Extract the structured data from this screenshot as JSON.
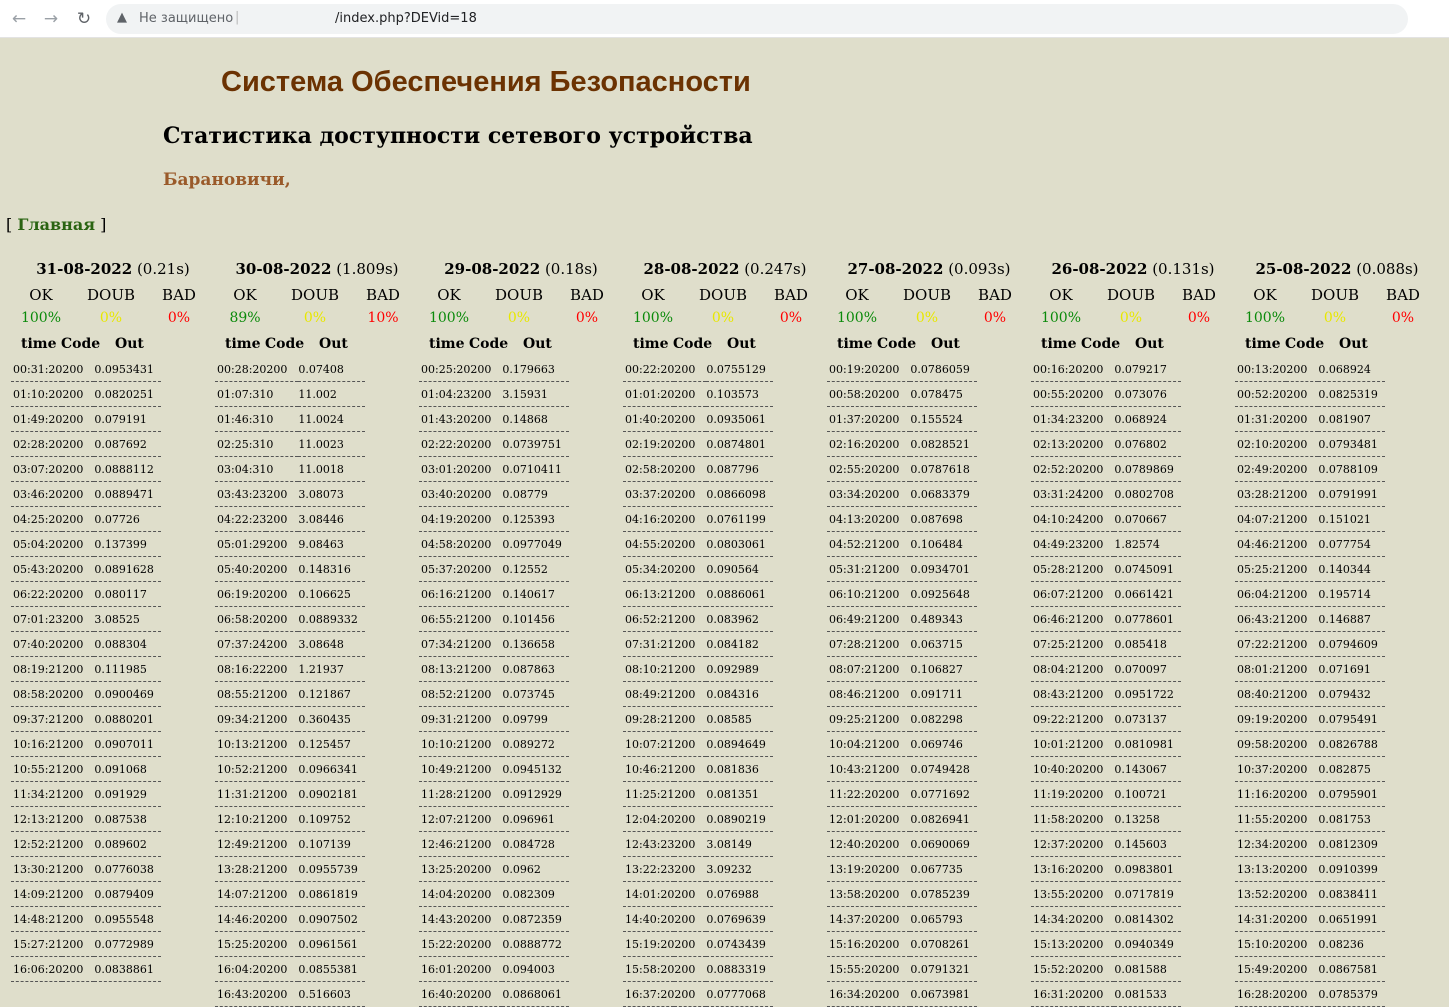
{
  "browser": {
    "security_label": "Не защищено",
    "url": "/index.php?DEVid=18"
  },
  "page": {
    "title": "Система Обеспечения Безопасности",
    "subtitle": "Статистика доступности сетевого устройства",
    "location": "Барановичи,",
    "nav": {
      "open_bracket": "[",
      "main_link": "Главная",
      "close_bracket": "]"
    }
  },
  "headers": {
    "ok": "OK",
    "doub": "DOUB",
    "bad": "BAD",
    "time": "time",
    "code": "Code",
    "out": "Out"
  },
  "colors": {
    "ok": "#0a8a0a",
    "doub": "#e8e800",
    "bad": "#ff0000",
    "title": "#6b3202",
    "link": "#2a6412",
    "location": "#9a5a2a"
  },
  "days": [
    {
      "date": "31-08-2022",
      "duration": "(0.21s)",
      "ok": "100%",
      "doub": "0%",
      "bad": "0%",
      "rows": [
        [
          "00:31:20",
          "200",
          "0.0953431"
        ],
        [
          "01:10:20",
          "200",
          "0.0820251"
        ],
        [
          "01:49:20",
          "200",
          "0.079191"
        ],
        [
          "02:28:20",
          "200",
          "0.087692"
        ],
        [
          "03:07:20",
          "200",
          "0.0888112"
        ],
        [
          "03:46:20",
          "200",
          "0.0889471"
        ],
        [
          "04:25:20",
          "200",
          "0.07726"
        ],
        [
          "05:04:20",
          "200",
          "0.137399"
        ],
        [
          "05:43:20",
          "200",
          "0.0891628"
        ],
        [
          "06:22:20",
          "200",
          "0.080117"
        ],
        [
          "07:01:23",
          "200",
          "3.08525"
        ],
        [
          "07:40:20",
          "200",
          "0.088304"
        ],
        [
          "08:19:21",
          "200",
          "0.111985"
        ],
        [
          "08:58:20",
          "200",
          "0.0900469"
        ],
        [
          "09:37:21",
          "200",
          "0.0880201"
        ],
        [
          "10:16:21",
          "200",
          "0.0907011"
        ],
        [
          "10:55:21",
          "200",
          "0.091068"
        ],
        [
          "11:34:21",
          "200",
          "0.091929"
        ],
        [
          "12:13:21",
          "200",
          "0.087538"
        ],
        [
          "12:52:21",
          "200",
          "0.089602"
        ],
        [
          "13:30:21",
          "200",
          "0.0776038"
        ],
        [
          "14:09:21",
          "200",
          "0.0879409"
        ],
        [
          "14:48:21",
          "200",
          "0.0955548"
        ],
        [
          "15:27:21",
          "200",
          "0.0772989"
        ],
        [
          "16:06:20",
          "200",
          "0.0838861"
        ]
      ]
    },
    {
      "date": "30-08-2022",
      "duration": "(1.809s)",
      "ok": "89%",
      "doub": "0%",
      "bad": "10%",
      "rows": [
        [
          "00:28:20",
          "200",
          "0.07408"
        ],
        [
          "01:07:31",
          "0",
          "11.002"
        ],
        [
          "01:46:31",
          "0",
          "11.0024"
        ],
        [
          "02:25:31",
          "0",
          "11.0023"
        ],
        [
          "03:04:31",
          "0",
          "11.0018"
        ],
        [
          "03:43:23",
          "200",
          "3.08073"
        ],
        [
          "04:22:23",
          "200",
          "3.08446"
        ],
        [
          "05:01:29",
          "200",
          "9.08463"
        ],
        [
          "05:40:20",
          "200",
          "0.148316"
        ],
        [
          "06:19:20",
          "200",
          "0.106625"
        ],
        [
          "06:58:20",
          "200",
          "0.0889332"
        ],
        [
          "07:37:24",
          "200",
          "3.08648"
        ],
        [
          "08:16:22",
          "200",
          "1.21937"
        ],
        [
          "08:55:21",
          "200",
          "0.121867"
        ],
        [
          "09:34:21",
          "200",
          "0.360435"
        ],
        [
          "10:13:21",
          "200",
          "0.125457"
        ],
        [
          "10:52:21",
          "200",
          "0.0966341"
        ],
        [
          "11:31:21",
          "200",
          "0.0902181"
        ],
        [
          "12:10:21",
          "200",
          "0.109752"
        ],
        [
          "12:49:21",
          "200",
          "0.107139"
        ],
        [
          "13:28:21",
          "200",
          "0.0955739"
        ],
        [
          "14:07:21",
          "200",
          "0.0861819"
        ],
        [
          "14:46:20",
          "200",
          "0.0907502"
        ],
        [
          "15:25:20",
          "200",
          "0.0961561"
        ],
        [
          "16:04:20",
          "200",
          "0.0855381"
        ],
        [
          "16:43:20",
          "200",
          "0.516603"
        ]
      ]
    },
    {
      "date": "29-08-2022",
      "duration": "(0.18s)",
      "ok": "100%",
      "doub": "0%",
      "bad": "0%",
      "rows": [
        [
          "00:25:20",
          "200",
          "0.179663"
        ],
        [
          "01:04:23",
          "200",
          "3.15931"
        ],
        [
          "01:43:20",
          "200",
          "0.14868"
        ],
        [
          "02:22:20",
          "200",
          "0.0739751"
        ],
        [
          "03:01:20",
          "200",
          "0.0710411"
        ],
        [
          "03:40:20",
          "200",
          "0.08779"
        ],
        [
          "04:19:20",
          "200",
          "0.125393"
        ],
        [
          "04:58:20",
          "200",
          "0.0977049"
        ],
        [
          "05:37:20",
          "200",
          "0.12552"
        ],
        [
          "06:16:21",
          "200",
          "0.140617"
        ],
        [
          "06:55:21",
          "200",
          "0.101456"
        ],
        [
          "07:34:21",
          "200",
          "0.136658"
        ],
        [
          "08:13:21",
          "200",
          "0.087863"
        ],
        [
          "08:52:21",
          "200",
          "0.073745"
        ],
        [
          "09:31:21",
          "200",
          "0.09799"
        ],
        [
          "10:10:21",
          "200",
          "0.089272"
        ],
        [
          "10:49:21",
          "200",
          "0.0945132"
        ],
        [
          "11:28:21",
          "200",
          "0.0912929"
        ],
        [
          "12:07:21",
          "200",
          "0.096961"
        ],
        [
          "12:46:21",
          "200",
          "0.084728"
        ],
        [
          "13:25:20",
          "200",
          "0.0962"
        ],
        [
          "14:04:20",
          "200",
          "0.082309"
        ],
        [
          "14:43:20",
          "200",
          "0.0872359"
        ],
        [
          "15:22:20",
          "200",
          "0.0888772"
        ],
        [
          "16:01:20",
          "200",
          "0.094003"
        ],
        [
          "16:40:20",
          "200",
          "0.0868061"
        ]
      ]
    },
    {
      "date": "28-08-2022",
      "duration": "(0.247s)",
      "ok": "100%",
      "doub": "0%",
      "bad": "0%",
      "rows": [
        [
          "00:22:20",
          "200",
          "0.0755129"
        ],
        [
          "01:01:20",
          "200",
          "0.103573"
        ],
        [
          "01:40:20",
          "200",
          "0.0935061"
        ],
        [
          "02:19:20",
          "200",
          "0.0874801"
        ],
        [
          "02:58:20",
          "200",
          "0.087796"
        ],
        [
          "03:37:20",
          "200",
          "0.0866098"
        ],
        [
          "04:16:20",
          "200",
          "0.0761199"
        ],
        [
          "04:55:20",
          "200",
          "0.0803061"
        ],
        [
          "05:34:20",
          "200",
          "0.090564"
        ],
        [
          "06:13:21",
          "200",
          "0.0886061"
        ],
        [
          "06:52:21",
          "200",
          "0.083962"
        ],
        [
          "07:31:21",
          "200",
          "0.084182"
        ],
        [
          "08:10:21",
          "200",
          "0.092989"
        ],
        [
          "08:49:21",
          "200",
          "0.084316"
        ],
        [
          "09:28:21",
          "200",
          "0.08585"
        ],
        [
          "10:07:21",
          "200",
          "0.0894649"
        ],
        [
          "10:46:21",
          "200",
          "0.081836"
        ],
        [
          "11:25:21",
          "200",
          "0.081351"
        ],
        [
          "12:04:20",
          "200",
          "0.0890219"
        ],
        [
          "12:43:23",
          "200",
          "3.08149"
        ],
        [
          "13:22:23",
          "200",
          "3.09232"
        ],
        [
          "14:01:20",
          "200",
          "0.076988"
        ],
        [
          "14:40:20",
          "200",
          "0.0769639"
        ],
        [
          "15:19:20",
          "200",
          "0.0743439"
        ],
        [
          "15:58:20",
          "200",
          "0.0883319"
        ],
        [
          "16:37:20",
          "200",
          "0.0777068"
        ]
      ]
    },
    {
      "date": "27-08-2022",
      "duration": "(0.093s)",
      "ok": "100%",
      "doub": "0%",
      "bad": "0%",
      "rows": [
        [
          "00:19:20",
          "200",
          "0.0786059"
        ],
        [
          "00:58:20",
          "200",
          "0.078475"
        ],
        [
          "01:37:20",
          "200",
          "0.155524"
        ],
        [
          "02:16:20",
          "200",
          "0.0828521"
        ],
        [
          "02:55:20",
          "200",
          "0.0787618"
        ],
        [
          "03:34:20",
          "200",
          "0.0683379"
        ],
        [
          "04:13:20",
          "200",
          "0.087698"
        ],
        [
          "04:52:21",
          "200",
          "0.106484"
        ],
        [
          "05:31:21",
          "200",
          "0.0934701"
        ],
        [
          "06:10:21",
          "200",
          "0.0925648"
        ],
        [
          "06:49:21",
          "200",
          "0.489343"
        ],
        [
          "07:28:21",
          "200",
          "0.063715"
        ],
        [
          "08:07:21",
          "200",
          "0.106827"
        ],
        [
          "08:46:21",
          "200",
          "0.091711"
        ],
        [
          "09:25:21",
          "200",
          "0.082298"
        ],
        [
          "10:04:21",
          "200",
          "0.069746"
        ],
        [
          "10:43:21",
          "200",
          "0.0749428"
        ],
        [
          "11:22:20",
          "200",
          "0.0771692"
        ],
        [
          "12:01:20",
          "200",
          "0.0826941"
        ],
        [
          "12:40:20",
          "200",
          "0.0690069"
        ],
        [
          "13:19:20",
          "200",
          "0.067735"
        ],
        [
          "13:58:20",
          "200",
          "0.0785239"
        ],
        [
          "14:37:20",
          "200",
          "0.065793"
        ],
        [
          "15:16:20",
          "200",
          "0.0708261"
        ],
        [
          "15:55:20",
          "200",
          "0.0791321"
        ],
        [
          "16:34:20",
          "200",
          "0.0673981"
        ]
      ]
    },
    {
      "date": "26-08-2022",
      "duration": "(0.131s)",
      "ok": "100%",
      "doub": "0%",
      "bad": "0%",
      "rows": [
        [
          "00:16:20",
          "200",
          "0.079217"
        ],
        [
          "00:55:20",
          "200",
          "0.073076"
        ],
        [
          "01:34:23",
          "200",
          "0.068924"
        ],
        [
          "02:13:20",
          "200",
          "0.076802"
        ],
        [
          "02:52:20",
          "200",
          "0.0789869"
        ],
        [
          "03:31:24",
          "200",
          "0.0802708"
        ],
        [
          "04:10:24",
          "200",
          "0.070667"
        ],
        [
          "04:49:23",
          "200",
          "1.82574"
        ],
        [
          "05:28:21",
          "200",
          "0.0745091"
        ],
        [
          "06:07:21",
          "200",
          "0.0661421"
        ],
        [
          "06:46:21",
          "200",
          "0.0778601"
        ],
        [
          "07:25:21",
          "200",
          "0.085418"
        ],
        [
          "08:04:21",
          "200",
          "0.070097"
        ],
        [
          "08:43:21",
          "200",
          "0.0951722"
        ],
        [
          "09:22:21",
          "200",
          "0.073137"
        ],
        [
          "10:01:21",
          "200",
          "0.0810981"
        ],
        [
          "10:40:20",
          "200",
          "0.143067"
        ],
        [
          "11:19:20",
          "200",
          "0.100721"
        ],
        [
          "11:58:20",
          "200",
          "0.13258"
        ],
        [
          "12:37:20",
          "200",
          "0.145603"
        ],
        [
          "13:16:20",
          "200",
          "0.0983801"
        ],
        [
          "13:55:20",
          "200",
          "0.0717819"
        ],
        [
          "14:34:20",
          "200",
          "0.0814302"
        ],
        [
          "15:13:20",
          "200",
          "0.0940349"
        ],
        [
          "15:52:20",
          "200",
          "0.081588"
        ],
        [
          "16:31:20",
          "200",
          "0.081533"
        ]
      ]
    },
    {
      "date": "25-08-2022",
      "duration": "(0.088s)",
      "ok": "100%",
      "doub": "0%",
      "bad": "0%",
      "rows": [
        [
          "00:13:20",
          "200",
          "0.068924"
        ],
        [
          "00:52:20",
          "200",
          "0.0825319"
        ],
        [
          "01:31:20",
          "200",
          "0.081907"
        ],
        [
          "02:10:20",
          "200",
          "0.0793481"
        ],
        [
          "02:49:20",
          "200",
          "0.0788109"
        ],
        [
          "03:28:21",
          "200",
          "0.0791991"
        ],
        [
          "04:07:21",
          "200",
          "0.151021"
        ],
        [
          "04:46:21",
          "200",
          "0.077754"
        ],
        [
          "05:25:21",
          "200",
          "0.140344"
        ],
        [
          "06:04:21",
          "200",
          "0.195714"
        ],
        [
          "06:43:21",
          "200",
          "0.146887"
        ],
        [
          "07:22:21",
          "200",
          "0.0794609"
        ],
        [
          "08:01:21",
          "200",
          "0.071691"
        ],
        [
          "08:40:21",
          "200",
          "0.079432"
        ],
        [
          "09:19:20",
          "200",
          "0.0795491"
        ],
        [
          "09:58:20",
          "200",
          "0.0826788"
        ],
        [
          "10:37:20",
          "200",
          "0.082875"
        ],
        [
          "11:16:20",
          "200",
          "0.0795901"
        ],
        [
          "11:55:20",
          "200",
          "0.081753"
        ],
        [
          "12:34:20",
          "200",
          "0.0812309"
        ],
        [
          "13:13:20",
          "200",
          "0.0910399"
        ],
        [
          "13:52:20",
          "200",
          "0.0838411"
        ],
        [
          "14:31:20",
          "200",
          "0.0651991"
        ],
        [
          "15:10:20",
          "200",
          "0.08236"
        ],
        [
          "15:49:20",
          "200",
          "0.0867581"
        ],
        [
          "16:28:20",
          "200",
          "0.0785379"
        ]
      ]
    }
  ]
}
